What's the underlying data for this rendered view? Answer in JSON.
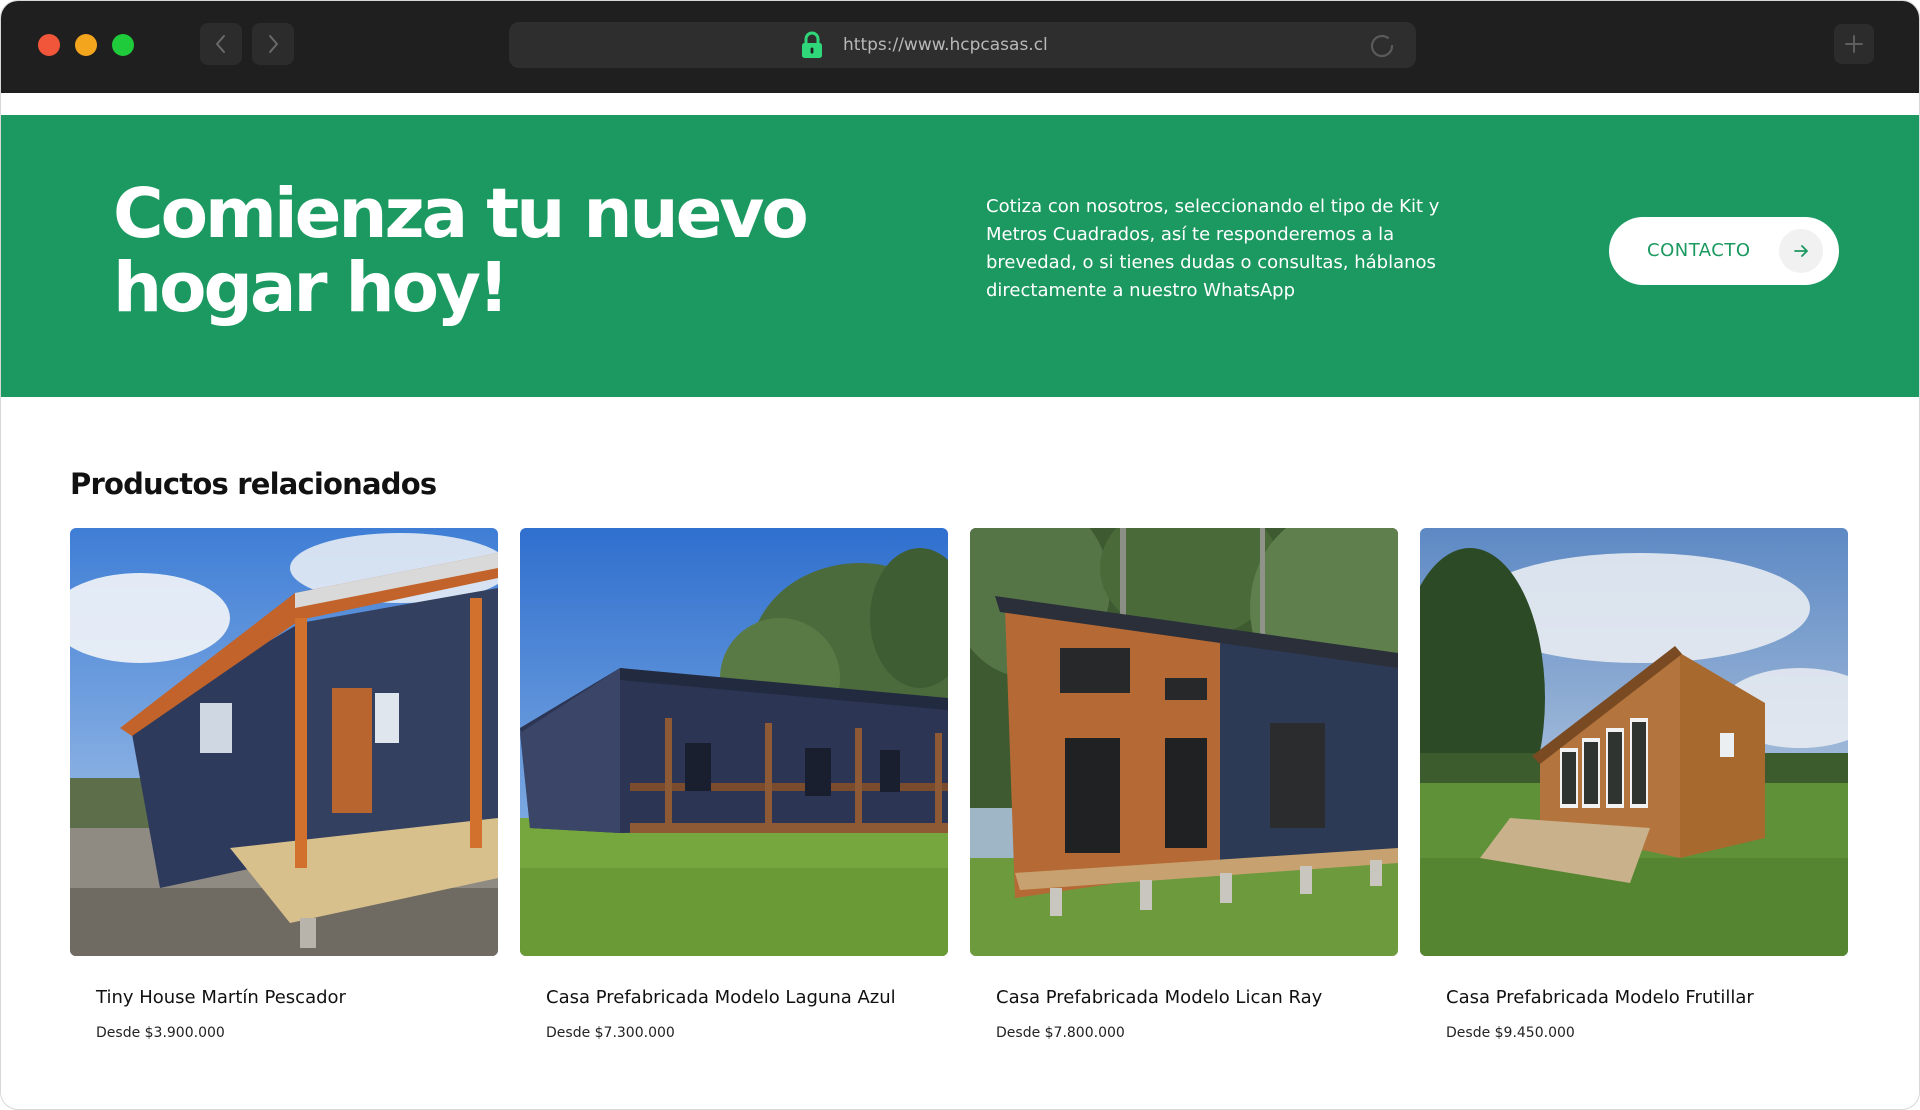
{
  "browser": {
    "url": "https://www.hcpcasas.cl",
    "icons": [
      "close-dot",
      "minimize-dot",
      "zoom-dot",
      "chevron-left-icon",
      "chevron-right-icon",
      "lock-icon",
      "reload-icon",
      "plus-icon"
    ]
  },
  "banner": {
    "title": "Comienza tu nuevo hogar hoy!",
    "text": "Cotiza con nosotros, seleccionando el tipo de Kit y Metros Cuadrados, así te responderemos a la brevedad, o si tienes dudas o consultas, háblanos directamente a nuestro WhatsApp",
    "button_label": "CONTACTO",
    "button_icon": "arrow-right-icon",
    "background_color": "#1c9960"
  },
  "products": {
    "title": "Productos relacionados",
    "items": [
      {
        "name": "Tiny House Martín Pescador",
        "price": "Desde $3.900.000"
      },
      {
        "name": "Casa Prefabricada Modelo Laguna Azul",
        "price": "Desde $7.300.000"
      },
      {
        "name": "Casa Prefabricada Modelo Lican Ray",
        "price": "Desde $7.800.000"
      },
      {
        "name": "Casa Prefabricada Modelo Frutillar",
        "price": "Desde $9.450.000"
      }
    ]
  }
}
